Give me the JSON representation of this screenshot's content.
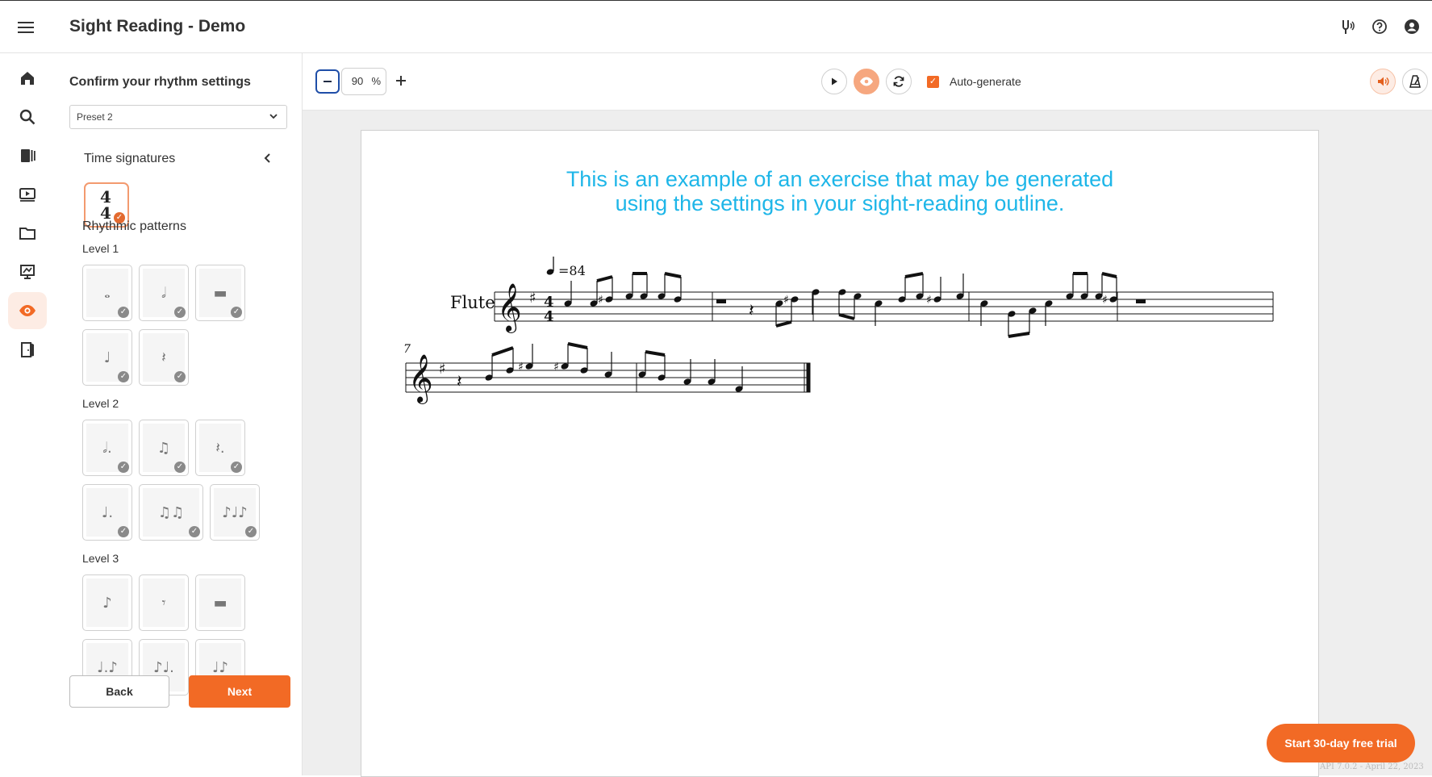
{
  "header": {
    "title": "Sight Reading - Demo",
    "icons": [
      "menu-icon",
      "tuning-fork-icon",
      "help-icon",
      "account-icon"
    ]
  },
  "rail": {
    "items": [
      "home-icon",
      "search-icon",
      "library-icon",
      "video-icon",
      "folder-icon",
      "assignment-icon",
      "sight-reading-icon",
      "exit-icon"
    ],
    "active": "sight-reading-icon"
  },
  "panel": {
    "title": "Confirm your rhythm settings",
    "preset_value": "Preset 2",
    "time_signatures_title": "Time signatures",
    "time_signature": {
      "top": "4",
      "bottom": "4"
    },
    "rhythmic_patterns_title": "Rhythmic patterns",
    "levels": [
      {
        "label": "Level 1",
        "patterns": [
          "whole-note",
          "half-note",
          "whole-rest",
          "quarter-note",
          "quarter-rest"
        ]
      },
      {
        "label": "Level 2",
        "patterns": [
          "dotted-half-note",
          "two-eighth-notes",
          "dotted-quarter-rest",
          "dotted-quarter-note",
          "four-eighth-notes",
          "eighth-quarter-eighth"
        ]
      },
      {
        "label": "Level 3",
        "patterns": [
          "eighth-note",
          "eighth-rest",
          "half-rest",
          "dotted-quarter-eighth",
          "eighth-dotted-quarter",
          "quarter-eighth"
        ]
      }
    ],
    "back_label": "Back",
    "next_label": "Next"
  },
  "toolbar": {
    "zoom_value": "90",
    "zoom_unit": "%",
    "autogenerate_label": "Auto-generate",
    "autogenerate_checked": true
  },
  "score": {
    "message_line1": "This is an example of an exercise that may be generated",
    "message_line2": "using the settings in your sight-reading outline.",
    "instrument": "Flute",
    "tempo": "=84",
    "measure_number": "7"
  },
  "footer": {
    "trial_label": "Start 30-day free trial",
    "api_version": "API 7.0.2 - April 22, 2023"
  },
  "colors": {
    "accent": "#f26a25",
    "message": "#1eb6e8"
  }
}
